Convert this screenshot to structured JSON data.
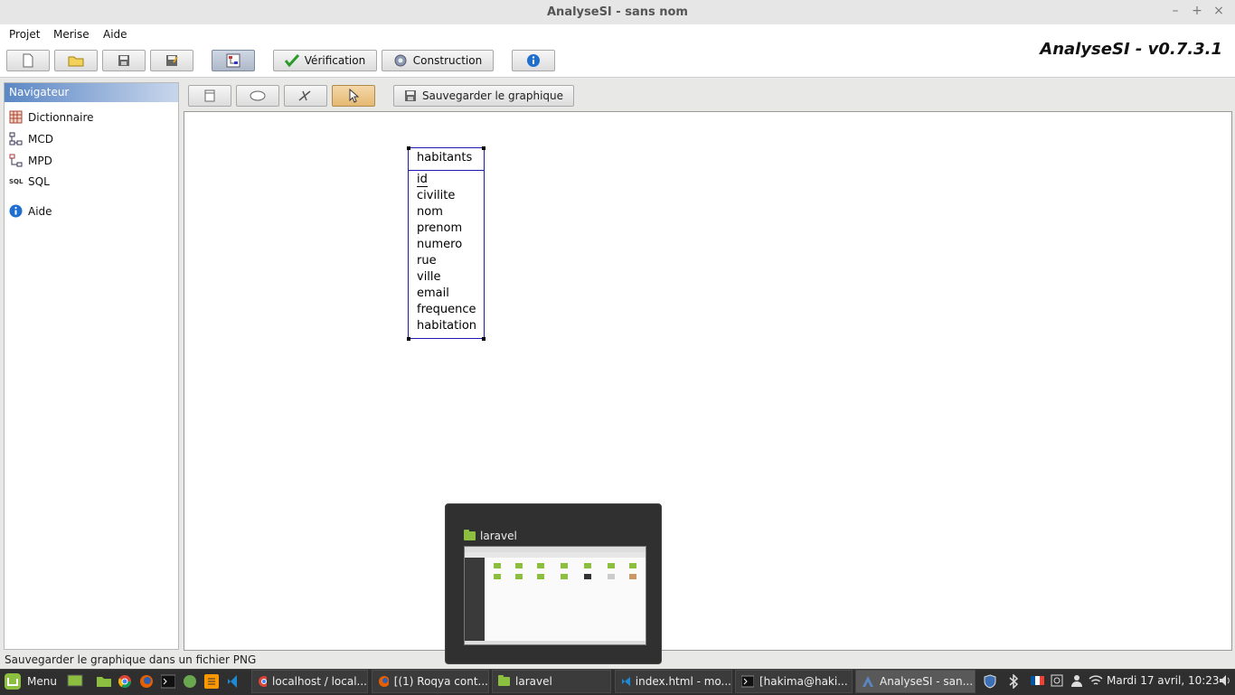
{
  "window": {
    "title": "AnalyseSI - sans nom",
    "minimize": "–",
    "maximize": "+",
    "close": "×"
  },
  "menu": {
    "projet": "Projet",
    "merise": "Merise",
    "aide": "Aide"
  },
  "brand": "AnalyseSI - v0.7.3.1",
  "toolbar": {
    "verification": "Vérification",
    "construction": "Construction"
  },
  "navigator": {
    "header": "Navigateur",
    "items": [
      {
        "label": "Dictionnaire",
        "icon": "table-icon"
      },
      {
        "label": "MCD",
        "icon": "mcd-diagram-icon"
      },
      {
        "label": "MPD",
        "icon": "mpd-diagram-icon"
      },
      {
        "label": "SQL",
        "icon": "sql-icon"
      },
      {
        "label": "Aide",
        "icon": "info-icon"
      }
    ],
    "sql_icon_text": "SQL"
  },
  "canvas_toolbar": {
    "save_graphic": "Sauvegarder le graphique"
  },
  "entity": {
    "name": "habitants",
    "attributes": [
      "id",
      "civilite",
      "nom",
      "prenom",
      "numero",
      "rue",
      "ville",
      "email",
      "frequence",
      "habitation"
    ]
  },
  "status": "Sauvegarder le graphique dans un fichier PNG",
  "taskbar": {
    "menu": "Menu",
    "windows": [
      {
        "label": "localhost / local...",
        "icon": "chrome-icon"
      },
      {
        "label": "[(1) Roqya cont...",
        "icon": "firefox-icon"
      },
      {
        "label": "laravel",
        "icon": "folder-icon"
      },
      {
        "label": "index.html - mo...",
        "icon": "vscode-icon"
      },
      {
        "label": "[hakima@haki...",
        "icon": "terminal-icon"
      },
      {
        "label": "AnalyseSI - san...",
        "icon": "analysesi-icon"
      }
    ],
    "clock": "Mardi 17 avril, 10:23"
  },
  "preview": {
    "title": "laravel"
  },
  "colors": {
    "entity_border": "#1b1bb0",
    "nav_header": "#5b87c5",
    "taskbar": "#2f2f2f"
  }
}
